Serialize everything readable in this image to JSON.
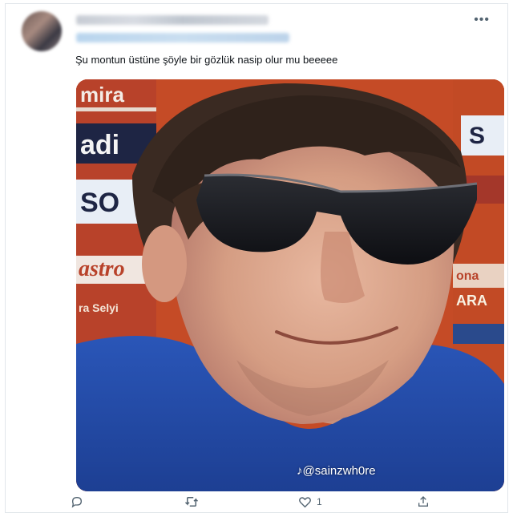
{
  "tweet": {
    "text": "Şu montun üstüne şöyle bir gözlük nasip olur mu beeeee",
    "more_icon": "more-dots-icon",
    "media": {
      "watermark": "@sainzwh0re",
      "ad_texts": [
        "mira",
        "adi",
        "SO",
        "astro",
        "ra Selyi",
        "ona",
        "ARA",
        "S"
      ]
    },
    "actions": {
      "reply_count": "",
      "retweet_count": "",
      "like_count": "1",
      "share_label": ""
    }
  }
}
